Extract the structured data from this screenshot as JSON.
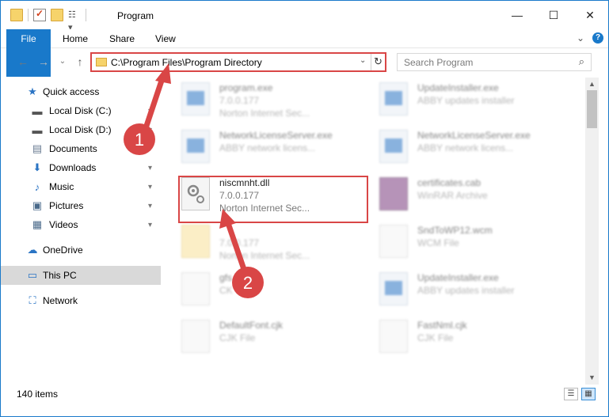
{
  "window": {
    "title": "Program",
    "controls": {
      "minimize": "—",
      "maximize": "☐",
      "close": "✕"
    }
  },
  "ribbon": {
    "tabs": [
      {
        "label": "File"
      },
      {
        "label": "Home"
      },
      {
        "label": "Share"
      },
      {
        "label": "View"
      }
    ],
    "expand_glyph": "⌄",
    "help_glyph": "?"
  },
  "nav": {
    "back": "←",
    "forward": "→",
    "recent": "⌄",
    "up": "↑"
  },
  "address": {
    "path": "C:\\Program Files\\Program Directory",
    "dropdown": "⌄",
    "refresh": "↻"
  },
  "search": {
    "placeholder": "Search Program",
    "icon": "⌕"
  },
  "navpane": {
    "items": [
      {
        "label": "Quick access",
        "icon": "★",
        "icon_name": "star-icon",
        "pinned": false
      },
      {
        "label": "Local Disk (C:)",
        "icon": "▬",
        "icon_name": "drive-icon",
        "pinned": true
      },
      {
        "label": "Local Disk (D:)",
        "icon": "▬",
        "icon_name": "drive-icon",
        "pinned": true
      },
      {
        "label": "Documents",
        "icon": "▤",
        "icon_name": "documents-icon",
        "pinned": true
      },
      {
        "label": "Downloads",
        "icon": "⬇",
        "icon_name": "downloads-icon",
        "pinned": true
      },
      {
        "label": "Music",
        "icon": "♪",
        "icon_name": "music-icon",
        "pinned": true
      },
      {
        "label": "Pictures",
        "icon": "▣",
        "icon_name": "pictures-icon",
        "pinned": true
      },
      {
        "label": "Videos",
        "icon": "▦",
        "icon_name": "videos-icon",
        "pinned": true
      },
      {
        "label": "OneDrive",
        "icon": "☁",
        "icon_name": "cloud-icon",
        "pinned": false
      },
      {
        "label": "This PC",
        "icon": "▭",
        "icon_name": "computer-icon",
        "pinned": false,
        "selected": true
      },
      {
        "label": "Network",
        "icon": "⛶",
        "icon_name": "network-icon",
        "pinned": false
      }
    ],
    "pin_glyph": "📌"
  },
  "files": [
    {
      "name": "program.exe",
      "line2": "7.0.0.177",
      "line3": "Norton Internet Sec...",
      "type": "exe",
      "blurred": true
    },
    {
      "name": "UpdateInstaller.exe",
      "line2": "ABBY updates installer",
      "line3": "",
      "type": "exe",
      "blurred": true
    },
    {
      "name": "NetworkLicenseServer.exe",
      "line2": "ABBY network licens...",
      "line3": "",
      "type": "exe",
      "blurred": true
    },
    {
      "name": "NetworkLicenseServer.exe",
      "line2": "ABBY network licens...",
      "line3": "",
      "type": "exe",
      "blurred": true
    },
    {
      "name": "niscmnht.dll",
      "line2": "7.0.0.177",
      "line3": "Norton Internet Sec...",
      "type": "dll",
      "blurred": false
    },
    {
      "name": "certificates.cab",
      "line2": "WinRAR Archive",
      "line3": "",
      "type": "cab",
      "blurred": true
    },
    {
      "name": "",
      "line2": "7.0.0.177",
      "line3": "Norton Internet Sec...",
      "type": "folder",
      "blurred": true
    },
    {
      "name": "SndToWP12.wcm",
      "line2": "WCM File",
      "line3": "",
      "type": "generic",
      "blurred": true
    },
    {
      "name": "gfs",
      "line2": "CK",
      "line3": "",
      "type": "generic",
      "blurred": true
    },
    {
      "name": "UpdateInstaller.exe",
      "line2": "ABBY updates installer",
      "line3": "",
      "type": "exe",
      "blurred": true
    },
    {
      "name": "DefaultFont.cjk",
      "line2": "CJK File",
      "line3": "",
      "type": "generic",
      "blurred": true
    },
    {
      "name": "FastNml.cjk",
      "line2": "CJK File",
      "line3": "",
      "type": "generic",
      "blurred": true
    }
  ],
  "annotations": {
    "badge1": "1",
    "badge2": "2",
    "accent": "#d94646"
  },
  "status": {
    "count": "140 items",
    "details_view": "☰",
    "icons_view": "▦"
  },
  "scrollbar": {
    "up": "▲",
    "down": "▼"
  },
  "colors": {
    "accent": "#1979ca",
    "highlight": "#d94646",
    "selected": "#d9d9d9"
  }
}
